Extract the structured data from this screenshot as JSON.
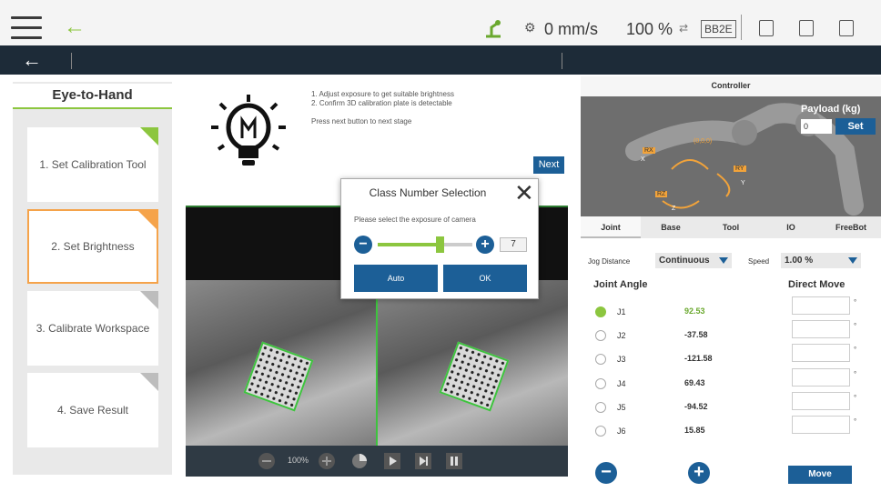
{
  "topbar": {
    "speed": "0 mm/s",
    "percent": "100 %",
    "badge": "BB2E"
  },
  "steps": {
    "title": "Eye-to-Hand",
    "items": [
      {
        "label": "1. Set Calibration Tool"
      },
      {
        "label": "2. Set Brightness"
      },
      {
        "label": "3. Calibrate Workspace"
      },
      {
        "label": "4.  Save Result"
      }
    ]
  },
  "instructions": {
    "line1": "1. Adjust exposure to get suitable brightness",
    "line2": "2. Confirm 3D calibration plate is detectable",
    "line3": "Press next button to next stage",
    "next_label": "Next"
  },
  "camera_bar": {
    "zoom": "100%"
  },
  "dialog": {
    "title": "Class Number Selection",
    "subtitle": "Please select the exposure of camera",
    "value": "7",
    "slider_level": 0.65,
    "auto_label": "Auto",
    "ok_label": "OK"
  },
  "controller": {
    "title": "Controller",
    "payload_label": "Payload (kg)",
    "payload_value": "0",
    "set_label": "Set",
    "axes": {
      "rx": "RX",
      "ry": "RY",
      "rz": "RZ",
      "x": "X",
      "y": "Y",
      "z": "Z",
      "origin": "(0,0,0)"
    },
    "tabs": [
      "Joint",
      "Base",
      "Tool",
      "IO",
      "FreeBot"
    ],
    "jog_distance_label": "Jog Distance",
    "jog_distance_value": "Continuous",
    "speed_label": "Speed",
    "speed_value": "1.00 %",
    "joint_angle_label": "Joint Angle",
    "direct_move_label": "Direct Move",
    "joints": [
      {
        "name": "J1",
        "value": "92.53",
        "selected": true
      },
      {
        "name": "J2",
        "value": "-37.58",
        "selected": false
      },
      {
        "name": "J3",
        "value": "-121.58",
        "selected": false
      },
      {
        "name": "J4",
        "value": "69.43",
        "selected": false
      },
      {
        "name": "J5",
        "value": "-94.52",
        "selected": false
      },
      {
        "name": "J6",
        "value": "15.85",
        "selected": false
      }
    ],
    "degree_symbol": "°",
    "move_label": "Move"
  },
  "colors": {
    "accent_green": "#8cc63f",
    "primary_blue": "#1c5f97",
    "nav_dark": "#1d2b38",
    "step_active_orange": "#f5a34a"
  }
}
